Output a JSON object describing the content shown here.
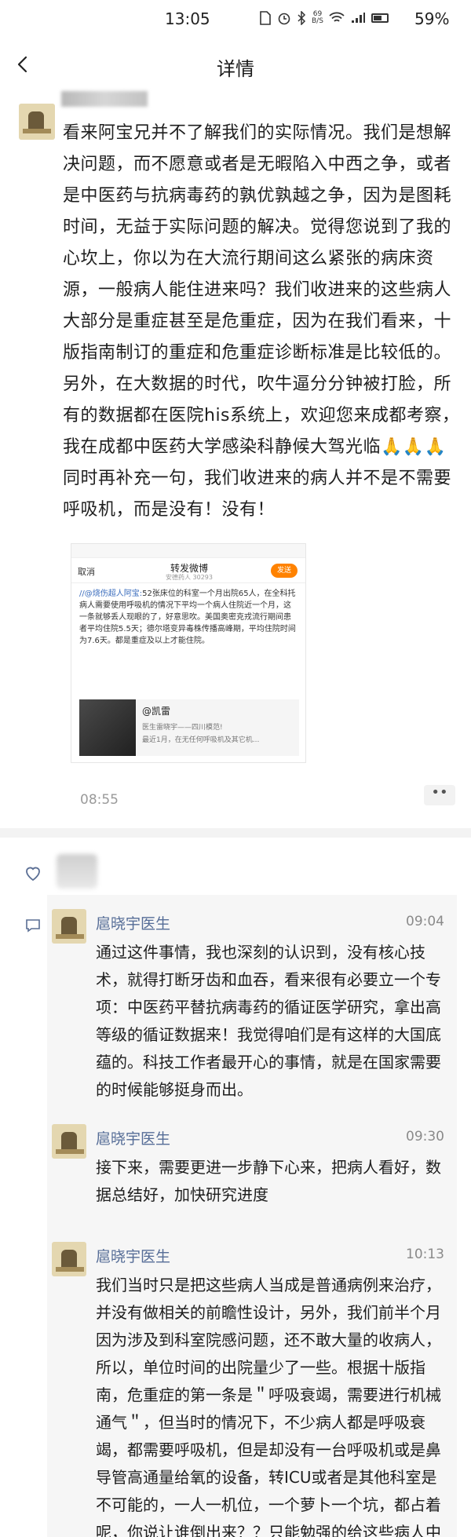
{
  "status_bar": {
    "time": "13:05",
    "net_speed_top": "69",
    "net_speed_bottom": "B/S",
    "battery": "59%"
  },
  "nav": {
    "title": "详情"
  },
  "post": {
    "paragraphs": [
      "看来阿宝兄并不了解我们的实际情况。我们是想解决问题，而不愿意或者是无暇陷入中西之争，或者是中医药与抗病毒药的孰优孰越之争，因为是图耗时间，无益于实际问题的解决。觉得您说到了我的心坎上，你以为在大流行期间这么紧张的病床资源，一般病人能住进来吗？我们收进来的这些病人大部分是重症甚至是危重症，因为在我们看来，十版指南制订的重症和危重症诊断标准是比较低的。另外，在大数据的时代，吹牛逼分分钟被打脸，所有的数据都在医院his系统上，欢迎您来成都考察，我在成都中医药大学感染科静候大驾光临🙏🙏🙏",
      "同时再补充一句，我们收进来的病人并不是不需要呼吸机，而是没有！没有！"
    ],
    "time": "08:55",
    "more": "••"
  },
  "embed": {
    "cancel": "取消",
    "title": "转发微博",
    "subtitle": "安德药人 30293",
    "send": "发送",
    "mention": "//@烧伤超人阿宝:",
    "body": "52张床位的科室一个月出院65人，在全科托病人需要使用呼吸机的情况下平均一个病人住院近一个月，这一条就够丢人现眼的了，好意思吹。美国奥密克戎流行期间患者平均住院5.5天；德尔塔变异毒株传播高峰期，平均住院时间为7.6天。都是重症及以上才能住院。",
    "card_title": "@凯雷",
    "card_line1": "医生雷晓宇——四川模范!",
    "card_line2": "最近1月，在无任何呼吸机及其它机..."
  },
  "comments": [
    {
      "name": "扈晓宇医生",
      "time": "09:04",
      "text": "通过这件事情，我也深刻的认识到，没有核心技术，就得打断牙齿和血吞，看来很有必要立一个专项：中医药平替抗病毒药的循证医学研究，拿出高等级的循证数据来！我觉得咱们是有这样的大国底蕴的。科技工作者最开心的事情，就是在国家需要的时候能够挺身而出。"
    },
    {
      "name": "扈晓宇医生",
      "time": "09:30",
      "text": "接下来，需要更进一步静下心来，把病人看好，数据总结好，加快研究进度"
    },
    {
      "name": "扈晓宇医生",
      "time": "10:13",
      "text": "我们当时只是把这些病人当成是普通病例来治疗，并没有做相关的前瞻性设计，另外，我们前半个月因为涉及到科室院感问题，还不敢大量的收病人，所以，单位时间的出院量少了一些。根据十版指南，危重症的第一条是＂呼吸衰竭，需要进行机械通气＂，但当时的情况下，不少病人都是呼吸衰竭，都需要呼吸机，但是却没有一台呼吸机或是鼻导管高通量给氧的设备，转ICU或者是其他科室是不可能的，一人一机位，一个萝卜一个坑，都占着呢，你说让谁倒出来？？只能勉强的给这些病人中药和常规的对症处理，否则你说怎么办？但没想到的是，这些病人也熬过来了，只死了一个"
    }
  ],
  "colors": {
    "name_link": "#566d97",
    "send_button": "#ff8200",
    "mention": "#3b6dbd"
  }
}
